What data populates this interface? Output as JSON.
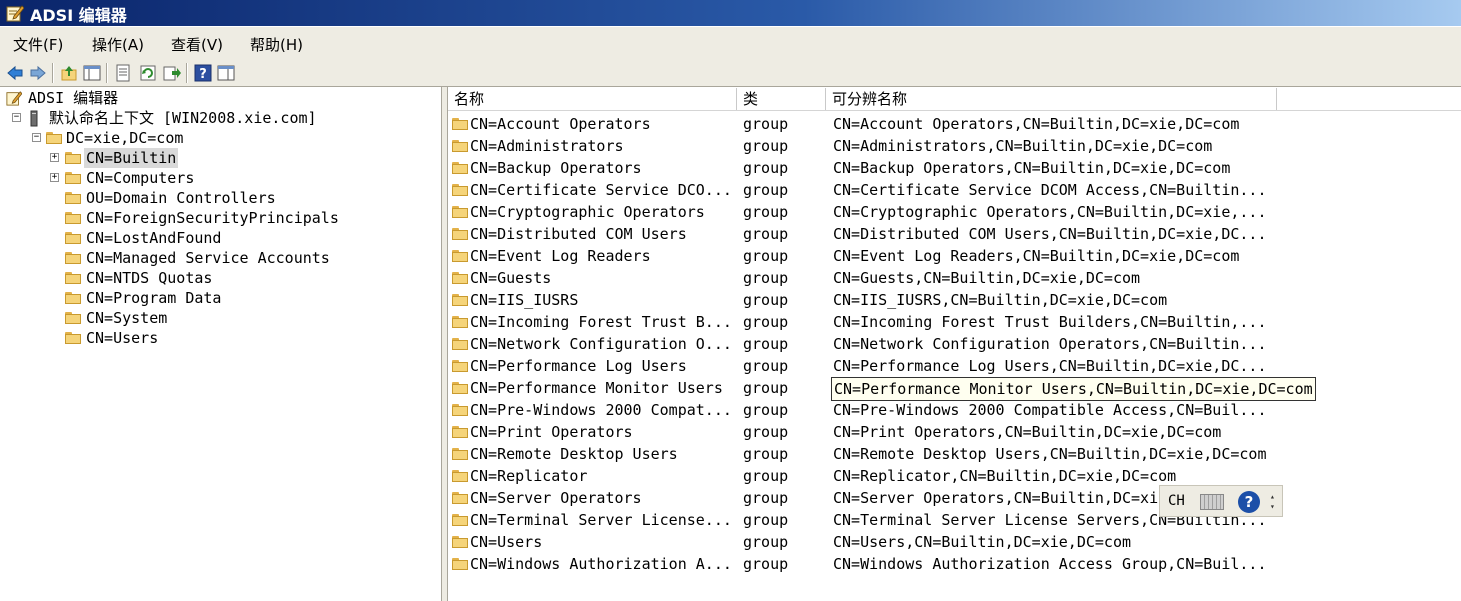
{
  "window": {
    "title": "ADSI 编辑器"
  },
  "menu": [
    {
      "label": "文件(F)"
    },
    {
      "label": "操作(A)"
    },
    {
      "label": "查看(V)"
    },
    {
      "label": "帮助(H)"
    }
  ],
  "toolbar": {
    "icons": [
      "back-icon",
      "forward-icon",
      "up-level-icon",
      "show-hide-tree-icon",
      "properties-icon",
      "refresh-icon",
      "export-list-icon",
      "help-icon",
      "show-action-pane-icon"
    ]
  },
  "tree": {
    "root": "ADSI 编辑器",
    "context": "默认命名上下文 [WIN2008.xie.com]",
    "domain": "DC=xie,DC=com",
    "children": [
      {
        "label": "CN=Builtin",
        "expandable": true,
        "selected": true
      },
      {
        "label": "CN=Computers",
        "expandable": true
      },
      {
        "label": "OU=Domain Controllers"
      },
      {
        "label": "CN=ForeignSecurityPrincipals"
      },
      {
        "label": "CN=LostAndFound"
      },
      {
        "label": "CN=Managed Service Accounts"
      },
      {
        "label": "CN=NTDS Quotas"
      },
      {
        "label": "CN=Program Data"
      },
      {
        "label": "CN=System"
      },
      {
        "label": "CN=Users"
      }
    ]
  },
  "list": {
    "columns": [
      "名称",
      "类",
      "可分辨名称"
    ],
    "rows": [
      {
        "name": "CN=Account Operators",
        "class": "group",
        "dn": "CN=Account Operators,CN=Builtin,DC=xie,DC=com"
      },
      {
        "name": "CN=Administrators",
        "class": "group",
        "dn": "CN=Administrators,CN=Builtin,DC=xie,DC=com"
      },
      {
        "name": "CN=Backup Operators",
        "class": "group",
        "dn": "CN=Backup Operators,CN=Builtin,DC=xie,DC=com"
      },
      {
        "name": "CN=Certificate Service DCO...",
        "class": "group",
        "dn": "CN=Certificate Service DCOM Access,CN=Builtin..."
      },
      {
        "name": "CN=Cryptographic Operators",
        "class": "group",
        "dn": "CN=Cryptographic Operators,CN=Builtin,DC=xie,..."
      },
      {
        "name": "CN=Distributed COM Users",
        "class": "group",
        "dn": "CN=Distributed COM Users,CN=Builtin,DC=xie,DC..."
      },
      {
        "name": "CN=Event Log Readers",
        "class": "group",
        "dn": "CN=Event Log Readers,CN=Builtin,DC=xie,DC=com"
      },
      {
        "name": "CN=Guests",
        "class": "group",
        "dn": "CN=Guests,CN=Builtin,DC=xie,DC=com"
      },
      {
        "name": "CN=IIS_IUSRS",
        "class": "group",
        "dn": "CN=IIS_IUSRS,CN=Builtin,DC=xie,DC=com"
      },
      {
        "name": "CN=Incoming Forest Trust B...",
        "class": "group",
        "dn": "CN=Incoming Forest Trust Builders,CN=Builtin,..."
      },
      {
        "name": "CN=Network Configuration O...",
        "class": "group",
        "dn": "CN=Network Configuration Operators,CN=Builtin..."
      },
      {
        "name": "CN=Performance Log Users",
        "class": "group",
        "dn": "CN=Performance Log Users,CN=Builtin,DC=xie,DC..."
      },
      {
        "name": "CN=Performance Monitor Users",
        "class": "group",
        "dn": "CN=Performance Monitor Users,CN=Builtin,DC=xie,DC=com",
        "tooltip": true
      },
      {
        "name": "CN=Pre-Windows 2000 Compat...",
        "class": "group",
        "dn": "CN=Pre-Windows 2000 Compatible Access,CN=Buil..."
      },
      {
        "name": "CN=Print Operators",
        "class": "group",
        "dn": "CN=Print Operators,CN=Builtin,DC=xie,DC=com"
      },
      {
        "name": "CN=Remote Desktop Users",
        "class": "group",
        "dn": "CN=Remote Desktop Users,CN=Builtin,DC=xie,DC=com"
      },
      {
        "name": "CN=Replicator",
        "class": "group",
        "dn": "CN=Replicator,CN=Builtin,DC=xie,DC=com"
      },
      {
        "name": "CN=Server Operators",
        "class": "group",
        "dn": "CN=Server Operators,CN=Builtin,DC=xi"
      },
      {
        "name": "CN=Terminal Server License...",
        "class": "group",
        "dn": "CN=Terminal Server License Servers,CN=Builtin..."
      },
      {
        "name": "CN=Users",
        "class": "group",
        "dn": "CN=Users,CN=Builtin,DC=xie,DC=com"
      },
      {
        "name": "CN=Windows Authorization A...",
        "class": "group",
        "dn": "CN=Windows Authorization Access Group,CN=Buil..."
      }
    ]
  },
  "language_bar": {
    "label": "CH"
  },
  "colors": {
    "title_start": "#0a246a",
    "title_end": "#a6caf0",
    "folder": "#f5d47a",
    "selection": "#d9d9d9"
  }
}
